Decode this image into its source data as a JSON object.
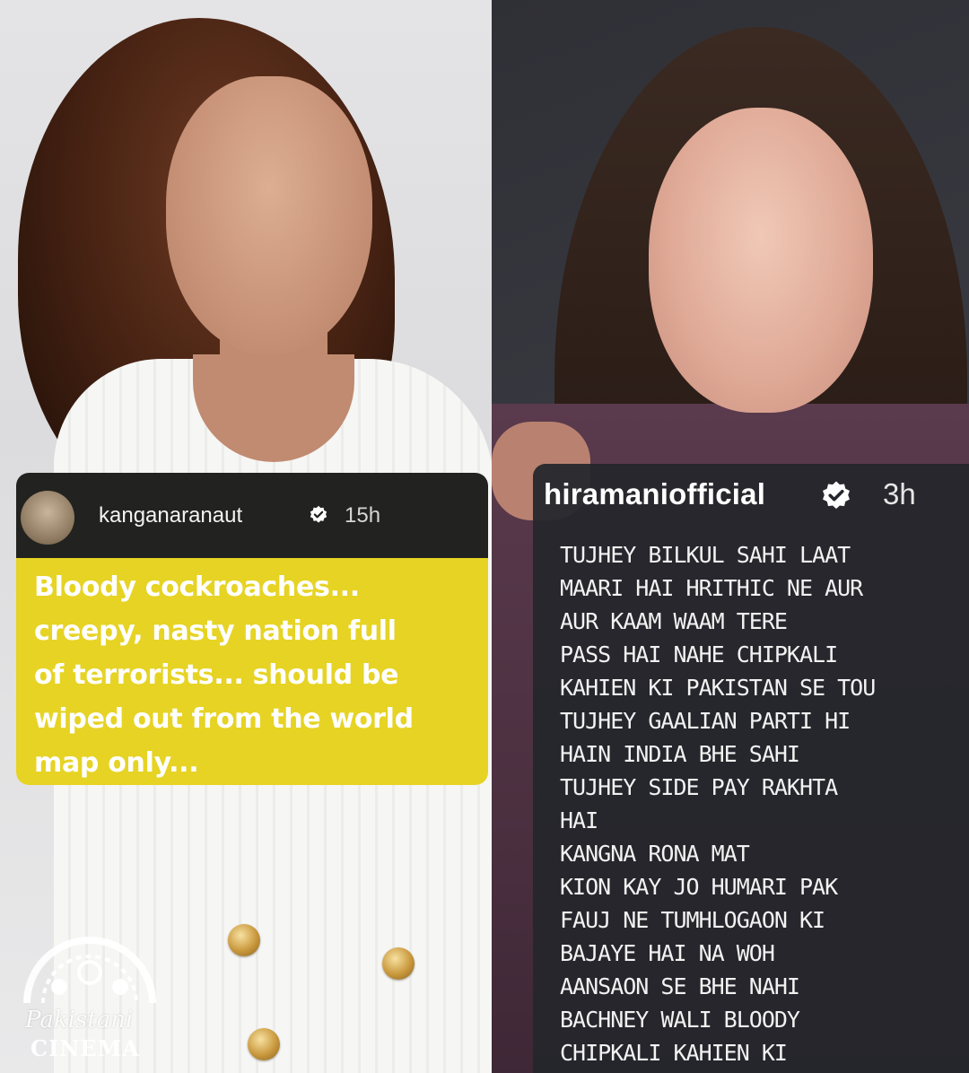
{
  "left_post": {
    "username": "kanganaranaut",
    "timestamp": "15h",
    "message": "Bloody cockroaches...\ncreepy, nasty nation full\nof terrorists... should be\nwiped out from the world\nmap only...",
    "body_color": "#e6d324"
  },
  "right_post": {
    "username": "hiramaniofficial",
    "timestamp": "3h",
    "message": "TUJHEY BILKUL SAHI LAAT\nMAARI HAI HRITHIC NE AUR\nAUR KAAM WAAM TERE\nPASS HAI NAHE CHIPKALI\nKAHIEN KI PAKISTAN SE TOU\nTUJHEY GAALIAN PARTI HI\nHAIN INDIA BHE SAHI\nTUJHEY SIDE PAY RAKHTA\nHAI\nKANGNA RONA MAT\nKION KAY JO HUMARI PAK\nFAUJ NE TUMHLOGAON KI\nBAJAYE HAI NA WOH\nAANSAON SE BHE NAHI\nBACHNEY WALI BLOODY\nCHIPKALI KAHIEN KI"
  },
  "watermark": {
    "line1": "Pakistani",
    "line2": "CINEMA"
  },
  "icons": {
    "verified": "verified-badge-icon",
    "logo": "cinema-logo-icon"
  }
}
